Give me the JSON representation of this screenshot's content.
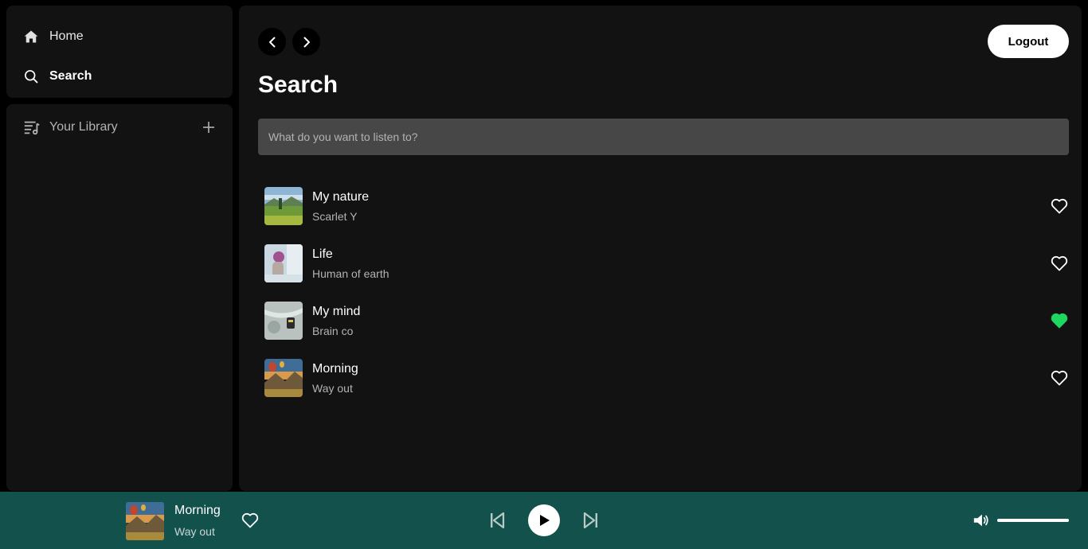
{
  "sidebar": {
    "nav": [
      {
        "label": "Home",
        "icon": "home-icon"
      },
      {
        "label": "Search",
        "icon": "search-icon"
      }
    ],
    "library": {
      "label": "Your Library",
      "icon": "library-icon",
      "add_icon": "plus-icon"
    }
  },
  "main": {
    "title": "Search",
    "logout_label": "Logout",
    "search_placeholder": "What do you want to listen to?",
    "tracks": [
      {
        "title": "My nature",
        "artist": "Scarlet Y",
        "liked": false
      },
      {
        "title": "Life",
        "artist": "Human of earth",
        "liked": false
      },
      {
        "title": "My mind",
        "artist": "Brain co",
        "liked": true
      },
      {
        "title": "Morning",
        "artist": "Way out",
        "liked": false
      }
    ]
  },
  "player": {
    "title": "Morning",
    "artist": "Way out",
    "liked": false,
    "volume": 1.0
  },
  "colors": {
    "accent": "#1ed760",
    "player_bg": "#13524c",
    "panel_bg": "#121212",
    "input_bg": "#474747"
  }
}
